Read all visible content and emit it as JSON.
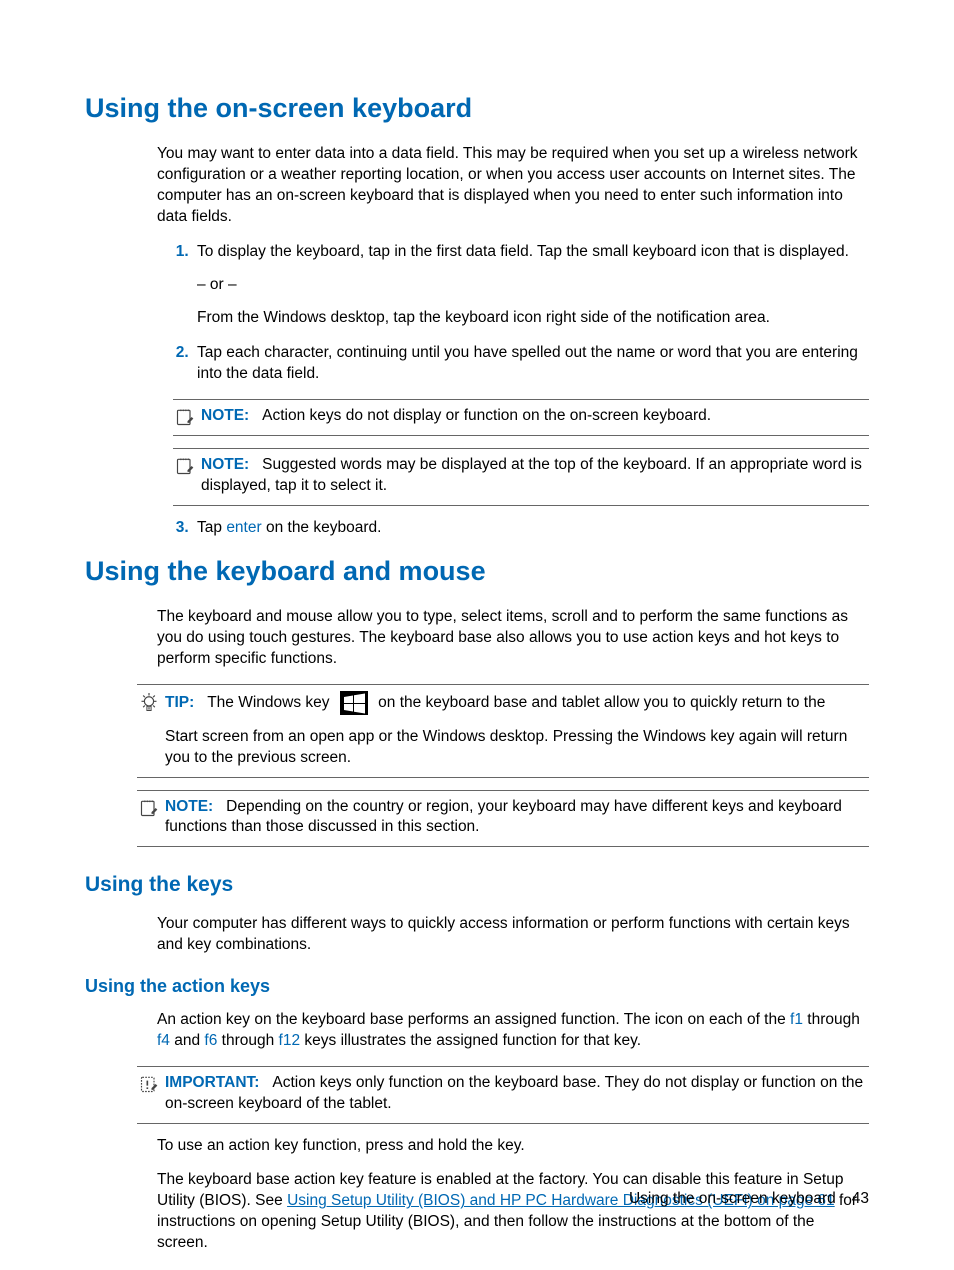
{
  "section1": {
    "title": "Using the on-screen keyboard",
    "intro": "You may want to enter data into a data field. This may be required when you set up a wireless network configuration or a weather reporting location, or when you access user accounts on Internet sites. The computer has an on-screen keyboard that is displayed when you need to enter such information into data fields.",
    "step1_line1": "To display the keyboard, tap in the first data field. Tap the small keyboard icon that is displayed.",
    "step1_or": "– or –",
    "step1_line2": "From the Windows desktop, tap the keyboard icon right side of the notification area.",
    "step2": "Tap each character, continuing until you have spelled out the name or word that you are entering into the data field.",
    "note1_label": "NOTE:",
    "note1_text": "Action keys do not display or function on the on-screen keyboard.",
    "note2_label": "NOTE:",
    "note2_text": "Suggested words may be displayed at the top of the keyboard. If an appropriate word is displayed, tap it to select it.",
    "step3_prefix": "Tap ",
    "step3_key": "enter",
    "step3_suffix": " on the keyboard."
  },
  "section2": {
    "title": "Using the keyboard and mouse",
    "intro": "The keyboard and mouse allow you to type, select items, scroll and to perform the same functions as you do using touch gestures. The keyboard base also allows you to use action keys and hot keys to perform specific functions.",
    "tip_label": "TIP:",
    "tip_pre": "The Windows key",
    "tip_post": "on the keyboard base and tablet allow you to quickly return to the",
    "tip_cont": "Start screen from an open app or the Windows desktop. Pressing the Windows key again will return you to the previous screen.",
    "note_label": "NOTE:",
    "note_text": "Depending on the country or region, your keyboard may have different keys and keyboard functions than those discussed in this section."
  },
  "section3": {
    "title": "Using the keys",
    "intro": "Your computer has different ways to quickly access information or perform functions with certain keys and key combinations."
  },
  "section4": {
    "title": "Using the action keys",
    "p1_pre": "An action key on the keyboard base performs an assigned function. The icon on each of the ",
    "p1_k1": "f1",
    "p1_m1": " through ",
    "p1_k2": "f4",
    "p1_m2": " and ",
    "p1_k3": "f6",
    "p1_m3": " through ",
    "p1_k4": "f12",
    "p1_suf": " keys illustrates the assigned function for that key.",
    "imp_label": "IMPORTANT:",
    "imp_text": "Action keys only function on the keyboard base. They do not display or function on the on-screen keyboard of the tablet.",
    "p2": "To use an action key function, press and hold the key.",
    "p3_pre": "The keyboard base action key feature is enabled at the factory. You can disable this feature in Setup Utility (BIOS). See ",
    "p3_link": "Using Setup Utility (BIOS) and HP PC Hardware Diagnostics (UEFI) on page 61",
    "p3_suf": " for instructions on opening Setup Utility (BIOS), and then follow the instructions at the bottom of the screen."
  },
  "footer": {
    "text": "Using the on-screen keyboard",
    "page": "43"
  }
}
